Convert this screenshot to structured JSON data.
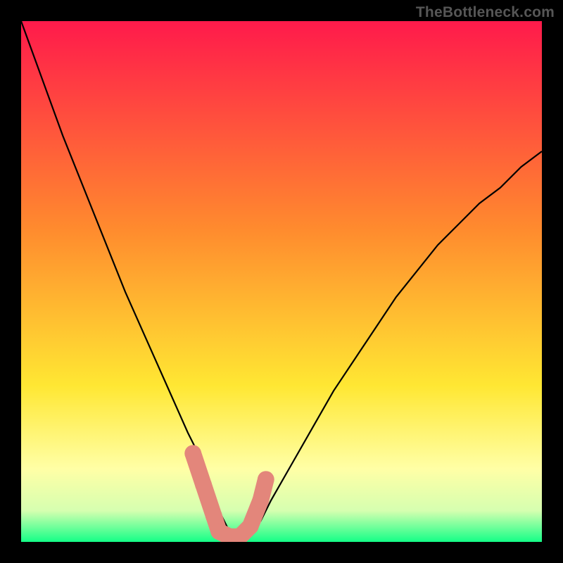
{
  "attribution": "TheBottleneck.com",
  "chart_data": {
    "type": "line",
    "title": "",
    "xlabel": "",
    "ylabel": "",
    "xlim": [
      0,
      100
    ],
    "ylim": [
      0,
      100
    ],
    "grid": false,
    "legend": false,
    "series": [
      {
        "name": "curve",
        "color": "#000000",
        "x": [
          0,
          4,
          8,
          12,
          16,
          20,
          24,
          28,
          32,
          34,
          36,
          37,
          38,
          39,
          40,
          41,
          42,
          43,
          44,
          46,
          48,
          52,
          56,
          60,
          64,
          68,
          72,
          76,
          80,
          84,
          88,
          92,
          96,
          100
        ],
        "y": [
          100,
          89,
          78,
          68,
          58,
          48,
          39,
          30,
          21,
          17,
          12,
          9,
          6,
          4,
          2,
          1,
          1,
          1,
          2,
          4,
          8,
          15,
          22,
          29,
          35,
          41,
          47,
          52,
          57,
          61,
          65,
          68,
          72,
          75
        ]
      },
      {
        "name": "marker-cluster",
        "color": "#e3867b",
        "x": [
          33,
          35,
          37,
          38,
          40,
          42,
          44,
          46,
          47
        ],
        "y": [
          17,
          11,
          5,
          2,
          1,
          1,
          3,
          8,
          12
        ]
      }
    ],
    "background_gradient": {
      "top": "#ff1a4b",
      "mid1": "#ff8b2e",
      "mid2": "#ffe733",
      "band": "#ffffa6",
      "bottom": "#14ff87"
    }
  }
}
